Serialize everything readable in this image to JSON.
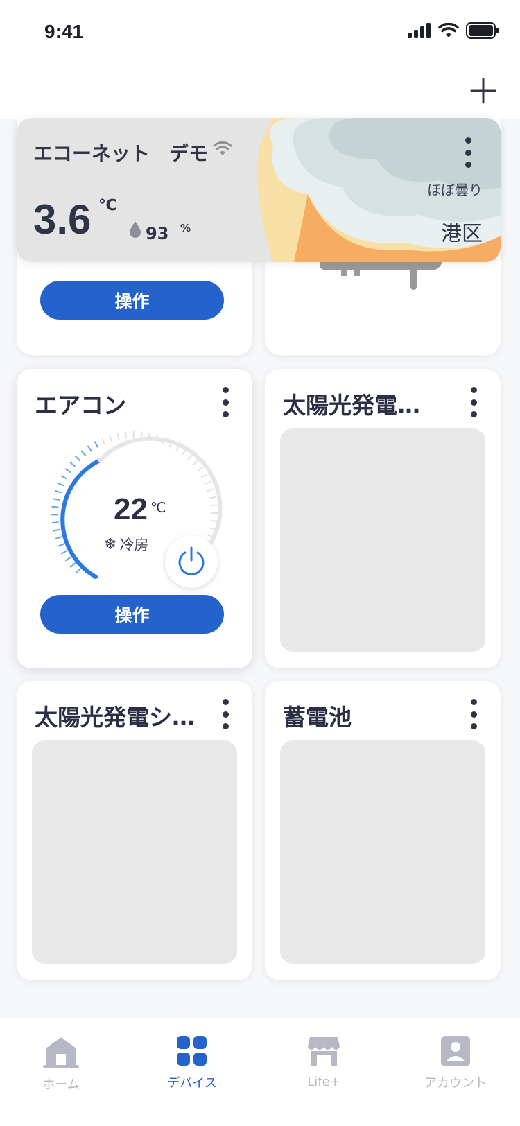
{
  "status": {
    "time": "9:41"
  },
  "weather": {
    "name": "エコーネット　デモ",
    "temp": "3.6",
    "temp_unit": "℃",
    "humidity": "93",
    "humidity_unit": "%",
    "condition": "ほぼ曇り",
    "area": "港区"
  },
  "cards": {
    "top_left": {
      "button_label": "操作"
    },
    "aircon": {
      "title": "エアコン",
      "set_temp": "22",
      "temp_unit": "℃",
      "mode": "冷房",
      "button_label": "操作"
    },
    "solar1": {
      "title": "太陽光発電…"
    },
    "solar2": {
      "title": "太陽光発電シ…"
    },
    "battery": {
      "title": "蓄電池"
    }
  },
  "tabs": [
    {
      "label": "ホーム",
      "icon": "home-icon",
      "active": false
    },
    {
      "label": "デバイス",
      "icon": "devices-grid-icon",
      "active": true
    },
    {
      "label": "Life+",
      "icon": "store-icon",
      "active": false
    },
    {
      "label": "アカウント",
      "icon": "account-icon",
      "active": false
    }
  ],
  "colors": {
    "accent": "#2463cc",
    "inactive": "#b6b8c6",
    "text": "#2f3447"
  }
}
